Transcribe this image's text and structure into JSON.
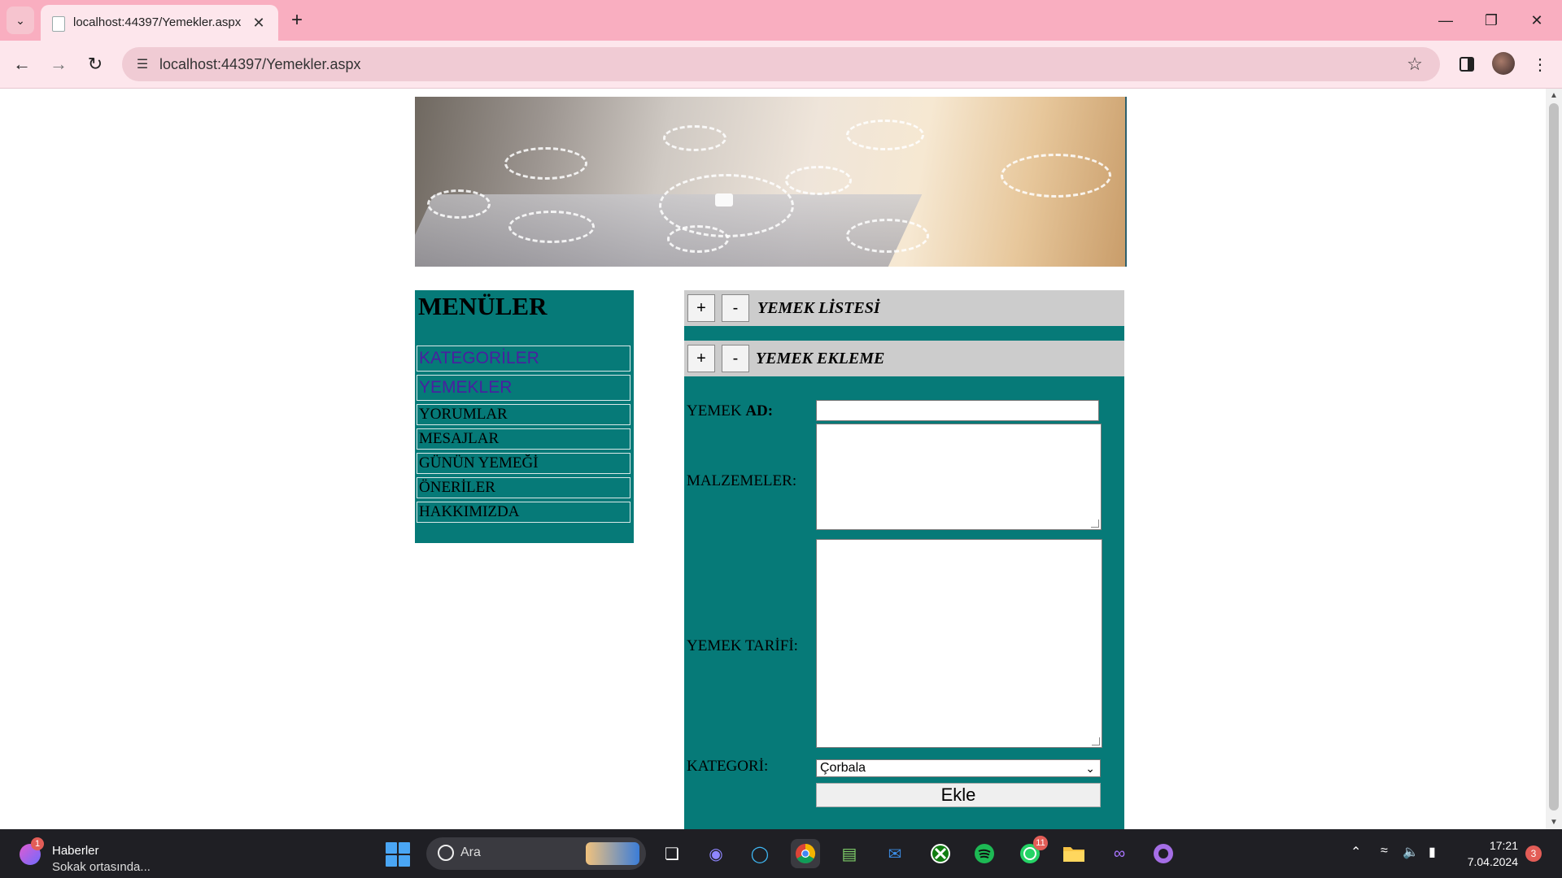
{
  "browser": {
    "tab_title": "localhost:44397/Yemekler.aspx",
    "url": "localhost:44397/Yemekler.aspx",
    "icons": {
      "back": "arrow-left-icon",
      "forward": "arrow-right-icon",
      "reload": "reload-icon",
      "bookmark": "star-icon",
      "menu": "kebab-menu-icon"
    }
  },
  "sidebar": {
    "title": "MENÜLER",
    "items": [
      {
        "label": "KATEGORİLER"
      },
      {
        "label": "YEMEKLER"
      },
      {
        "label": "YORUMLAR"
      },
      {
        "label": "MESAJLAR"
      },
      {
        "label": "GÜNÜN YEMEĞİ"
      },
      {
        "label": "ÖNERİLER"
      },
      {
        "label": "HAKKIMIZDA"
      }
    ]
  },
  "panel": {
    "list_section": {
      "plus": "+",
      "minus": "-",
      "title": "YEMEK LİSTESİ"
    },
    "add_section": {
      "plus": "+",
      "minus": "-",
      "title": "YEMEK EKLEME"
    },
    "form": {
      "name_label_prefix": "YEMEK ",
      "name_label_bold": "AD:",
      "name_value": "",
      "ingredients_label": "MALZEMELER:",
      "ingredients_value": "",
      "recipe_label": "YEMEK TARİFİ:",
      "recipe_value": "",
      "category_label": "KATEGORİ:",
      "category_selected": "Çorbala",
      "submit_label": "Ekle"
    }
  },
  "taskbar": {
    "news_badge": "1",
    "news_title": "Haberler",
    "news_subtitle": "Sokak ortasında...",
    "search_label": "Ara",
    "whatsapp_badge": "11",
    "time": "17:21",
    "date": "7.04.2024",
    "notification_count": "3"
  },
  "colors": {
    "teal": "#067a78",
    "section_gray": "#cccccc",
    "tabstrip_pink": "#f9aec0",
    "toolbar_pink": "#fde6ec",
    "link_purple": "#4a1fa0"
  }
}
